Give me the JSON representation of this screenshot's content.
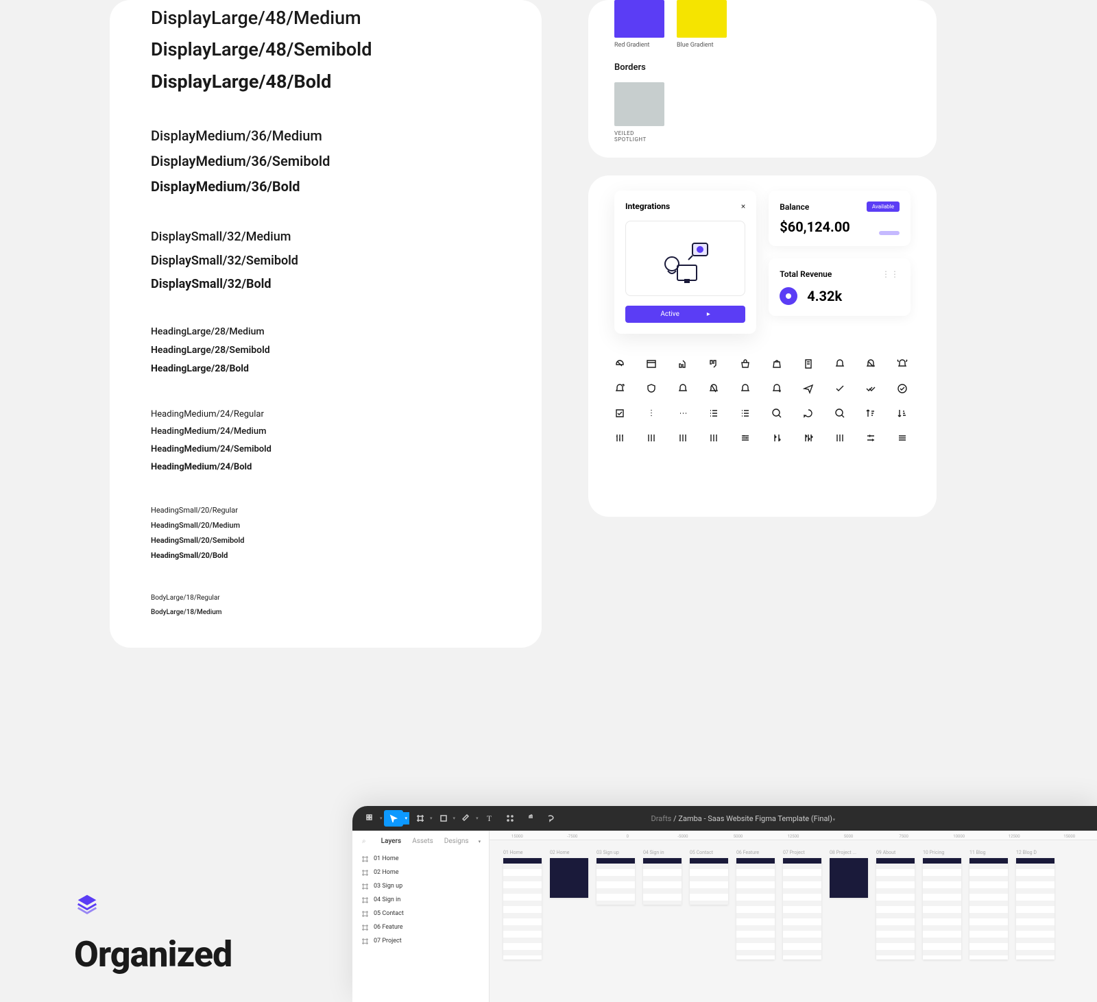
{
  "typography": {
    "displayLarge": [
      {
        "label": "DisplayLarge/48/Medium",
        "weight": "w500"
      },
      {
        "label": "DisplayLarge/48/Semibold",
        "weight": "w600"
      },
      {
        "label": "DisplayLarge/48/Bold",
        "weight": "w700"
      }
    ],
    "displayMedium": [
      {
        "label": "DisplayMedium/36/Medium",
        "weight": "w500"
      },
      {
        "label": "DisplayMedium/36/Semibold",
        "weight": "w600"
      },
      {
        "label": "DisplayMedium/36/Bold",
        "weight": "w700"
      }
    ],
    "displaySmall": [
      {
        "label": "DisplaySmall/32/Medium",
        "weight": "w500"
      },
      {
        "label": "DisplaySmall/32/Semibold",
        "weight": "w600"
      },
      {
        "label": "DisplaySmall/32/Bold",
        "weight": "w700"
      }
    ],
    "headingLarge": [
      {
        "label": "HeadingLarge/28/Medium",
        "weight": "w500"
      },
      {
        "label": "HeadingLarge/28/Semibold",
        "weight": "w600"
      },
      {
        "label": "HeadingLarge/28/Bold",
        "weight": "w700"
      }
    ],
    "headingMedium": [
      {
        "label": "HeadingMedium/24/Regular",
        "weight": "w400"
      },
      {
        "label": "HeadingMedium/24/Medium",
        "weight": "w500"
      },
      {
        "label": "HeadingMedium/24/Semibold",
        "weight": "w600"
      },
      {
        "label": "HeadingMedium/24/Bold",
        "weight": "w700"
      }
    ],
    "headingSmall": [
      {
        "label": "HeadingSmall/20/Regular",
        "weight": "w400"
      },
      {
        "label": "HeadingSmall/20/Medium",
        "weight": "w500"
      },
      {
        "label": "HeadingSmall/20/Semibold",
        "weight": "w600"
      },
      {
        "label": "HeadingSmall/20/Bold",
        "weight": "w700"
      }
    ],
    "bodyLarge": [
      {
        "label": "BodyLarge/18/Regular",
        "weight": "w400"
      },
      {
        "label": "BodyLarge/18/Medium",
        "weight": "w500"
      }
    ]
  },
  "swatches": {
    "row1": [
      {
        "name": "Red Gradient",
        "color": "#5b3df5"
      },
      {
        "name": "Blue Gradient",
        "color": "#f5e400"
      }
    ],
    "bordersTitle": "Borders",
    "border": {
      "name": "VEILED SPOTLIGHT",
      "color": "#c7cece"
    }
  },
  "integrations": {
    "title": "Integrations",
    "button": "Active"
  },
  "balance": {
    "label": "Balance",
    "badge": "Available",
    "value": "$60,124.00"
  },
  "revenue": {
    "label": "Total Revenue",
    "value": "4.32k"
  },
  "iconNames": [
    "dashboard-off-icon",
    "calendar-icon",
    "thumbs-up-icon",
    "thumbs-down-icon",
    "basket-icon",
    "bag-icon",
    "clipboard-icon",
    "bell-icon",
    "bell-off-icon",
    "bell-ring-icon",
    "bell-dot-icon",
    "shield-icon",
    "bell-outline-icon",
    "bell-slash-icon",
    "bell-alt-icon",
    "bell-check-icon",
    "send-icon",
    "check-icon",
    "check-all-icon",
    "check-circle-icon",
    "check-square-icon",
    "dots-vert-icon",
    "dots-horiz-icon",
    "list-icon",
    "list-ordered-icon",
    "search-icon",
    "chat-icon",
    "search-alt-icon",
    "sort-desc-icon",
    "sort-asc-icon",
    "sliders-v-icon",
    "sliders-up-icon",
    "sliders-alt-icon",
    "sliders-mix-icon",
    "settings-h-icon",
    "adjust-icon",
    "equalizer-icon",
    "tune-icon",
    "filter-icon",
    "options-icon"
  ],
  "organized": {
    "title": "Organized"
  },
  "figma": {
    "breadcrumbDrafts": "Drafts",
    "breadcrumbSep": "/",
    "fileName": "Zamba - Saas Website Figma Template (Final)",
    "sidebarTabs": {
      "layers": "Layers",
      "assets": "Assets",
      "designs": "Designs"
    },
    "layers": [
      "01 Home",
      "02 Home",
      "03 Sign up",
      "04 Sign in",
      "05 Contact",
      "06 Feature",
      "07 Project"
    ],
    "rulerTicks": [
      "15000",
      "-7500",
      "0",
      "-5000",
      "5000",
      "12500",
      "5000",
      "7500",
      "10000",
      "12500",
      "15000"
    ],
    "frames": [
      "01 Home",
      "02 Home",
      "03 Sign up",
      "04 Sign in",
      "05 Contact",
      "06 Feature",
      "07 Project",
      "08 Project ...",
      "09 About",
      "10 Pricing",
      "11 Blog",
      "12 Blog D"
    ]
  }
}
